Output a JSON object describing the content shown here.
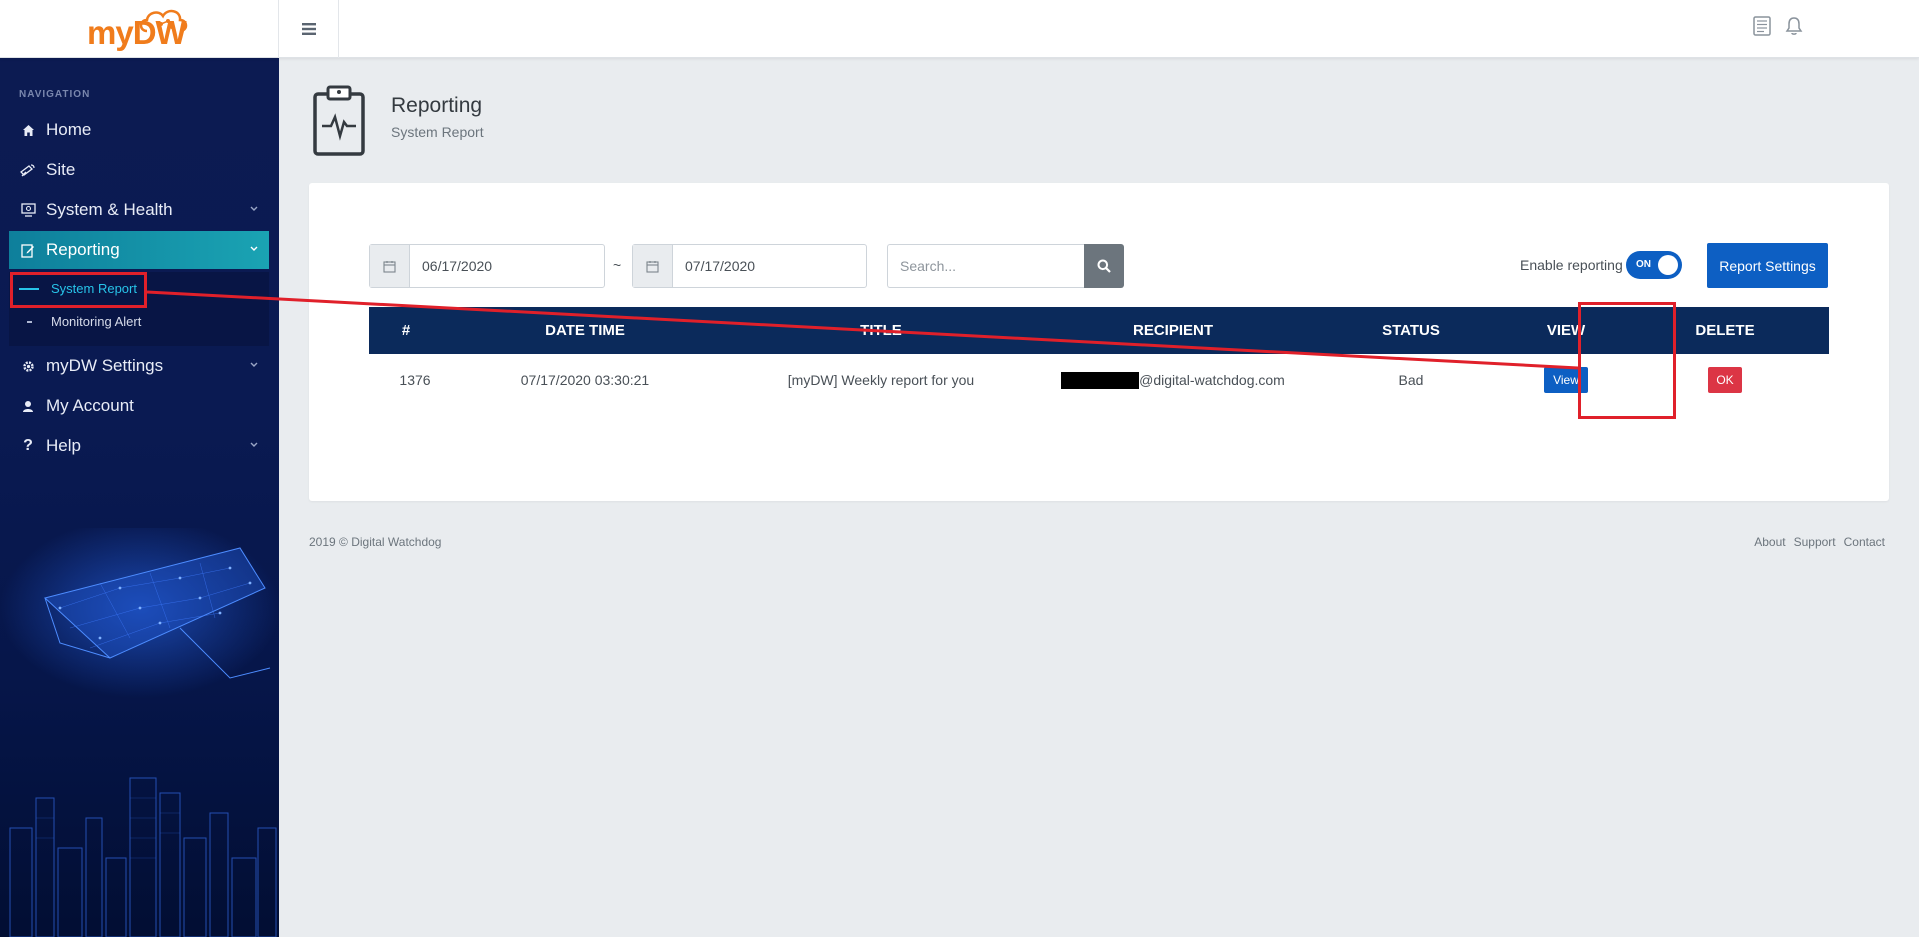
{
  "brand": {
    "logo_text": "myDW"
  },
  "topbar": {
    "menu_icon": "hamburger-icon",
    "icons": [
      "notes-icon",
      "bell-icon"
    ]
  },
  "sidebar": {
    "heading": "NAVIGATION",
    "items": [
      {
        "label": "Home",
        "icon": "home-icon"
      },
      {
        "label": "Site",
        "icon": "satellite-icon"
      },
      {
        "label": "System & Health",
        "icon": "monitor-icon"
      },
      {
        "label": "Reporting",
        "icon": "report-icon"
      },
      {
        "label": "myDW Settings",
        "icon": "gear-icon"
      },
      {
        "label": "My Account",
        "icon": "user-icon"
      },
      {
        "label": "Help",
        "icon": "question-icon"
      }
    ],
    "subitems": [
      {
        "label": "System Report"
      },
      {
        "label": "Monitoring Alert"
      }
    ],
    "active_item": "Reporting",
    "active_subitem": "System Report"
  },
  "page": {
    "title": "Reporting",
    "subtitle": "System Report"
  },
  "filters": {
    "date_from": "06/17/2020",
    "separator": "~",
    "date_to": "07/17/2020",
    "search_placeholder": "Search...",
    "enable_label": "Enable reporting",
    "toggle_text": "ON",
    "report_settings_label": "Report Settings"
  },
  "table": {
    "columns": [
      "#",
      "DATE TIME",
      "TITLE",
      "RECIPIENT",
      "STATUS",
      "VIEW",
      "DELETE"
    ],
    "rows": [
      {
        "id": "1376",
        "datetime": "07/17/2020 03:30:21",
        "title": "[myDW] Weekly report for you",
        "recipient_domain": "@digital-watchdog.com",
        "status": "Bad",
        "view_label": "View",
        "delete_label": "OK"
      }
    ]
  },
  "footer": {
    "copyright": "2019 © Digital Watchdog",
    "links": [
      "About",
      "Support",
      "Contact"
    ]
  },
  "colors": {
    "accent": "#0d5fc3",
    "danger": "#dc3545",
    "table_header": "#0b2a5b",
    "annotation": "#e0202a",
    "brand_orange": "#f07c1c"
  }
}
